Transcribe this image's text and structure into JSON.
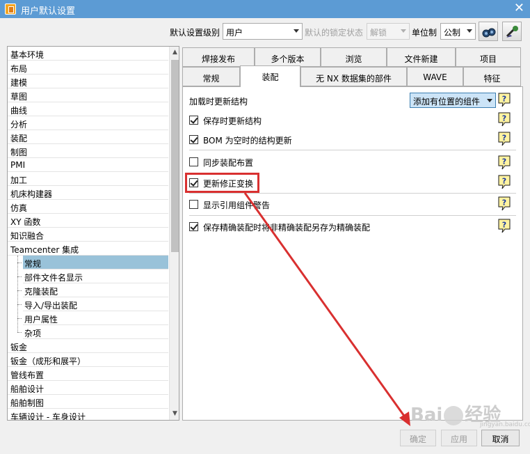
{
  "window": {
    "title": "用户默认设置",
    "close_glyph": "✕"
  },
  "toolbar": {
    "level_label": "默认设置级别",
    "level_value": "用户",
    "lock_label": "默认的锁定状态",
    "lock_value": "解锁",
    "unit_label": "单位制",
    "unit_value": "公制"
  },
  "tree": {
    "items": [
      "基本环境",
      "布局",
      "建模",
      "草图",
      "曲线",
      "分析",
      "装配",
      "制图",
      "PMI",
      "加工",
      "机床构建器",
      "仿真",
      "XY 函数",
      "知识融合",
      "Teamcenter 集成"
    ],
    "sub_items": [
      "常规",
      "部件文件名显示",
      "克隆装配",
      "导入/导出装配",
      "用户属性",
      "杂项"
    ],
    "selected": "常规",
    "items_after": [
      "钣金",
      "钣金（成形和展平）",
      "管线布置",
      "船舶设计",
      "船舶制图",
      "车辆设计 - 车身设计"
    ]
  },
  "tabs": {
    "row1": [
      "焊接发布",
      "多个版本",
      "浏览",
      "文件新建",
      "项目"
    ],
    "row2": [
      "常规",
      "装配",
      "无 NX 数据集的部件",
      "WAVE",
      "特征"
    ],
    "active": "装配"
  },
  "panel": {
    "load_update_label": "加载时更新结构",
    "load_update_value": "添加有位置的组件",
    "options": [
      {
        "label": "保存时更新结构",
        "checked": true
      },
      {
        "label": "BOM 为空时的结构更新",
        "checked": true
      },
      {
        "label": "同步装配布置",
        "checked": false
      },
      {
        "label": "更新修正变换",
        "checked": true
      },
      {
        "label": "显示引用组件警告",
        "checked": false
      },
      {
        "label": "保存精确装配时将非精确装配另存为精确装配",
        "checked": true
      }
    ]
  },
  "buttons": {
    "ok": "确定",
    "apply": "应用",
    "cancel": "取消"
  },
  "watermark": {
    "text_a": "Bai",
    "text_b": "经验",
    "sub": "jingyan.baidu.com"
  },
  "colors": {
    "titlebar": "#5c9bd4",
    "selection": "#99c2d9",
    "annotation": "#d93030"
  }
}
